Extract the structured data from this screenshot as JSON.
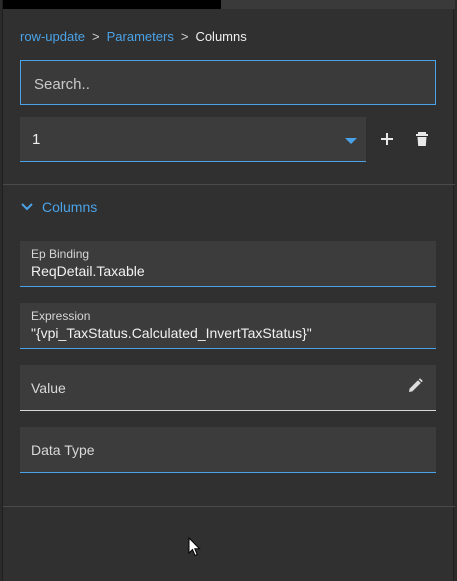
{
  "breadcrumb": {
    "items": [
      "row-update",
      "Parameters"
    ],
    "current": "Columns",
    "separator": ">"
  },
  "search": {
    "placeholder": "Search..",
    "value": ""
  },
  "selector": {
    "selected": "1"
  },
  "section": {
    "title": "Columns",
    "expanded": true
  },
  "fields": {
    "ep_binding": {
      "label": "Ep Binding",
      "value": "ReqDetail.Taxable"
    },
    "expression": {
      "label": "Expression",
      "value": "\"{vpi_TaxStatus.Calculated_InvertTaxStatus}\""
    },
    "value": {
      "placeholder": "Value"
    },
    "data_type": {
      "placeholder": "Data Type"
    }
  },
  "icons": {
    "add": "plus-icon",
    "delete": "trash-icon",
    "section_toggle": "chevron-down-icon",
    "edit": "pencil-icon",
    "select_caret": "caret-down-icon"
  },
  "colors": {
    "accent": "#4aa3e8",
    "panel_bg": "#303030",
    "field_bg": "#3c3c3c",
    "text": "#f2f2f2"
  }
}
